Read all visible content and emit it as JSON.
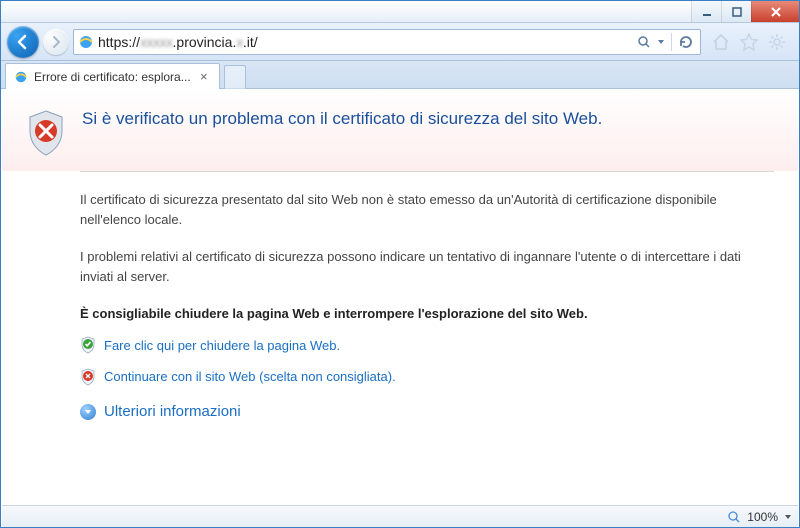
{
  "window": {
    "title_controls": {
      "min": "−",
      "max": "□",
      "close": "✕"
    }
  },
  "nav": {
    "url_prefix": "https://",
    "url_blur1": "xxxxx",
    "url_mid": ".provincia.",
    "url_blur2": "x",
    "url_suffix": ".it/"
  },
  "tab": {
    "title": "Errore di certificato: esplora..."
  },
  "page": {
    "title": "Si è verificato un problema con il certificato di sicurezza del sito Web.",
    "p1": "Il certificato di sicurezza presentato dal sito Web non è stato emesso da un'Autorità di certificazione disponibile nell'elenco locale.",
    "p2": "I problemi relativi al certificato di sicurezza possono indicare un tentativo di ingannare l'utente o di intercettare i dati inviati al server.",
    "recommend": "È consigliabile chiudere la pagina Web e interrompere l'esplorazione del sito Web.",
    "link_close": "Fare clic qui per chiudere la pagina Web.",
    "link_continue": "Continuare con il sito Web (scelta non consigliata).",
    "more_info": "Ulteriori informazioni"
  },
  "status": {
    "zoom": "100%"
  }
}
